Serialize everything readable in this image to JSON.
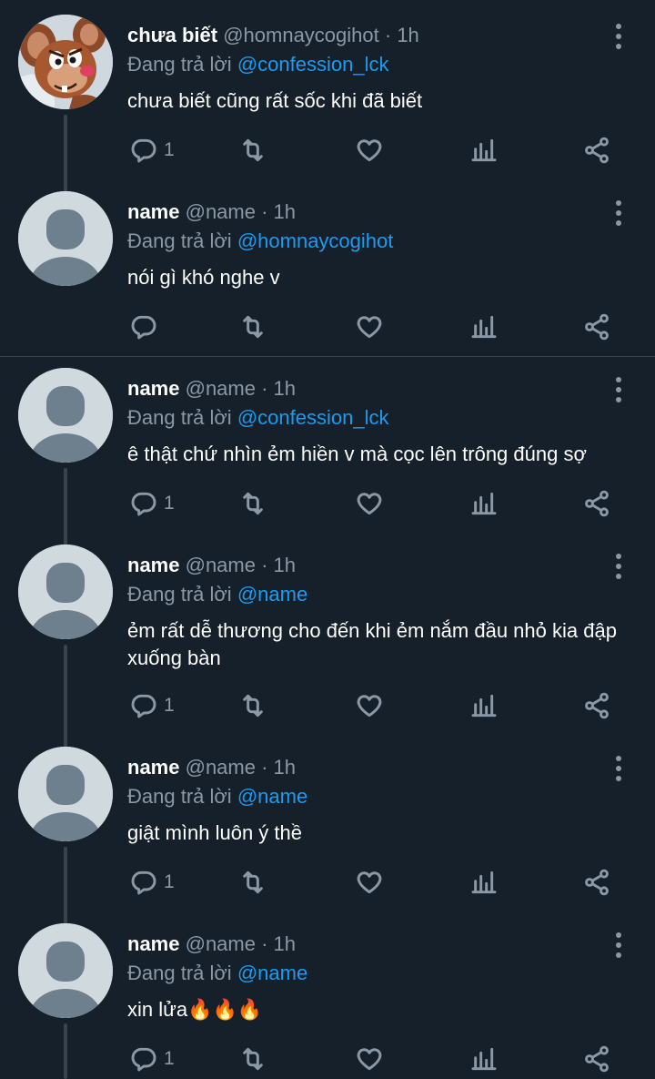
{
  "colors": {
    "background": "#15202b",
    "text": "#ffffff",
    "muted": "#8b98a5",
    "accent": "#1d9bf0",
    "line": "#38444d"
  },
  "icons": [
    "reply-icon",
    "retweet-icon",
    "like-icon",
    "views-icon",
    "share-icon",
    "more-icon"
  ],
  "tweets": [
    {
      "name": "chưa biết",
      "handle": "@homnaycogihot",
      "time": "· 1h",
      "replying_prefix": "Đang trả lời",
      "replying_to": "@confession_lck",
      "text": "chưa biết cũng rất sốc khi đã biết",
      "reply_count": "1"
    },
    {
      "name": "name",
      "handle": "@name",
      "time": "· 1h",
      "replying_prefix": "Đang trả lời",
      "replying_to": "@homnaycogihot",
      "text": "nói gì khó nghe v",
      "reply_count": ""
    },
    {
      "name": "name",
      "handle": "@name",
      "time": "· 1h",
      "replying_prefix": "Đang trả lời",
      "replying_to": "@confession_lck",
      "text": "ê thật chứ nhìn ẻm hiền v mà cọc lên trông đúng sợ",
      "reply_count": "1"
    },
    {
      "name": "name",
      "handle": "@name",
      "time": "· 1h",
      "replying_prefix": "Đang trả lời",
      "replying_to": "@name",
      "text": "ẻm rất dễ thương cho đến khi ẻm nắm đầu nhỏ kia đập xuống bàn",
      "reply_count": "1"
    },
    {
      "name": "name",
      "handle": "@name",
      "time": "· 1h",
      "replying_prefix": "Đang trả lời",
      "replying_to": "@name",
      "text": "giật mình luôn ý thề",
      "reply_count": "1"
    },
    {
      "name": "name",
      "handle": "@name",
      "time": "· 1h",
      "replying_prefix": "Đang trả lời",
      "replying_to": "@name",
      "text": "xin lửa🔥🔥🔥",
      "reply_count": "1"
    }
  ]
}
